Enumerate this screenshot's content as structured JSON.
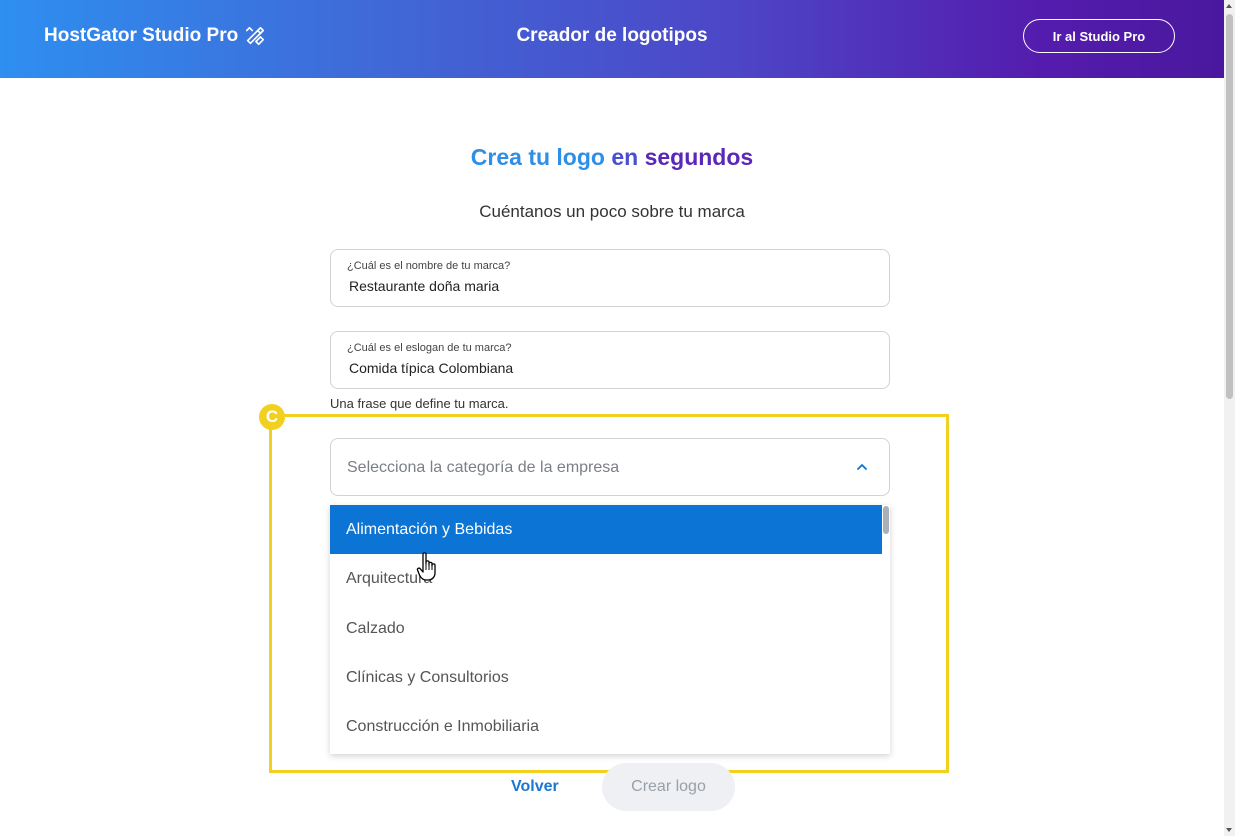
{
  "header": {
    "brand": "HostGator Studio Pro",
    "brand_icon": "pencil-ruler-icon",
    "title": "Creador de logotipos",
    "studio_button": "Ir al Studio Pro"
  },
  "main": {
    "title_part1": "Crea tu logo",
    "title_part2": "en",
    "title_part3": "segundos",
    "subtitle": "Cuéntanos un poco sobre tu marca"
  },
  "form": {
    "brand_name": {
      "label": "¿Cuál es el nombre de tu marca?",
      "value": "Restaurante doña maria"
    },
    "slogan": {
      "label": "¿Cuál es el eslogan de tu marca?",
      "value": "Comida típica Colombiana",
      "helper": "Una frase que define tu marca."
    },
    "category": {
      "placeholder": "Selecciona la categoría de la empresa",
      "expanded": true,
      "options": [
        "Alimentación y Bebidas",
        "Arquitectura",
        "Calzado",
        "Clínicas y Consultorios",
        "Construcción e Inmobiliaria"
      ],
      "highlighted_index": 0
    }
  },
  "annotation": {
    "badge": "C",
    "color": "#f2d020"
  },
  "actions": {
    "back": "Volver",
    "create": "Crear logo"
  },
  "colors": {
    "accent": "#0b74d4",
    "header_start": "#2e8ff0",
    "header_end": "#4a189e"
  }
}
